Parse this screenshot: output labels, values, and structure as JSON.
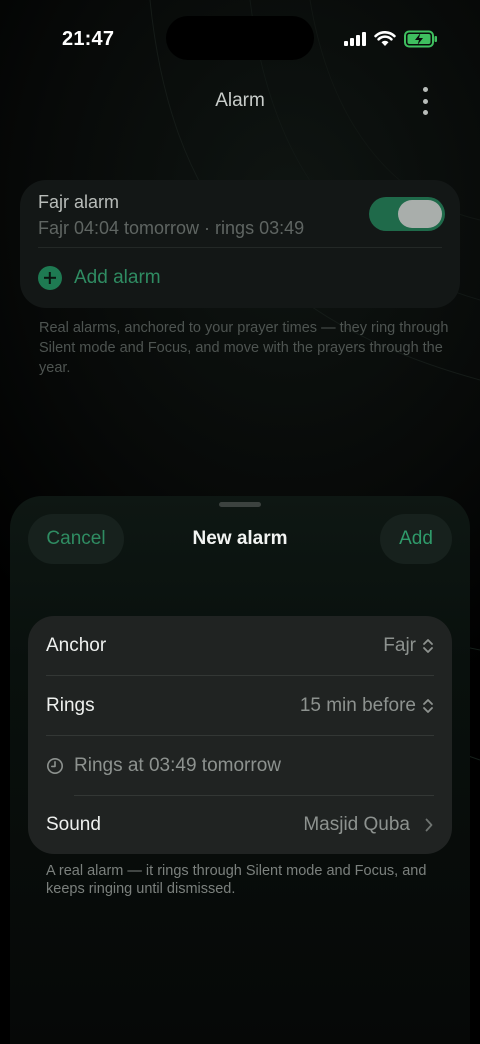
{
  "status_bar": {
    "time": "21:47"
  },
  "header": {
    "title": "Alarm"
  },
  "alarm_list": {
    "items": [
      {
        "title": "Fajr alarm",
        "subtitle": "Fajr 04:04 tomorrow · rings 03:49",
        "enabled": true
      }
    ],
    "add_label": "Add alarm",
    "footnote": "Real alarms, anchored to your prayer times — they ring through Silent mode and Focus, and move with the prayers through the year."
  },
  "sheet": {
    "title": "New alarm",
    "cancel_label": "Cancel",
    "add_label": "Add",
    "rows": {
      "anchor": {
        "label": "Anchor",
        "value": "Fajr"
      },
      "rings": {
        "label": "Rings",
        "value": "15 min before"
      },
      "ring_info": "Rings at 03:49 tomorrow",
      "sound": {
        "label": "Sound",
        "value": "Masjid Quba"
      }
    },
    "footnote": "A real alarm — it rings through Silent mode and Focus, and keeps ringing until dismissed."
  },
  "colors": {
    "accent": "#2f8c62",
    "toggle_on": "#1f6a4a",
    "card": "#131716",
    "sheet_card": "#202322"
  }
}
